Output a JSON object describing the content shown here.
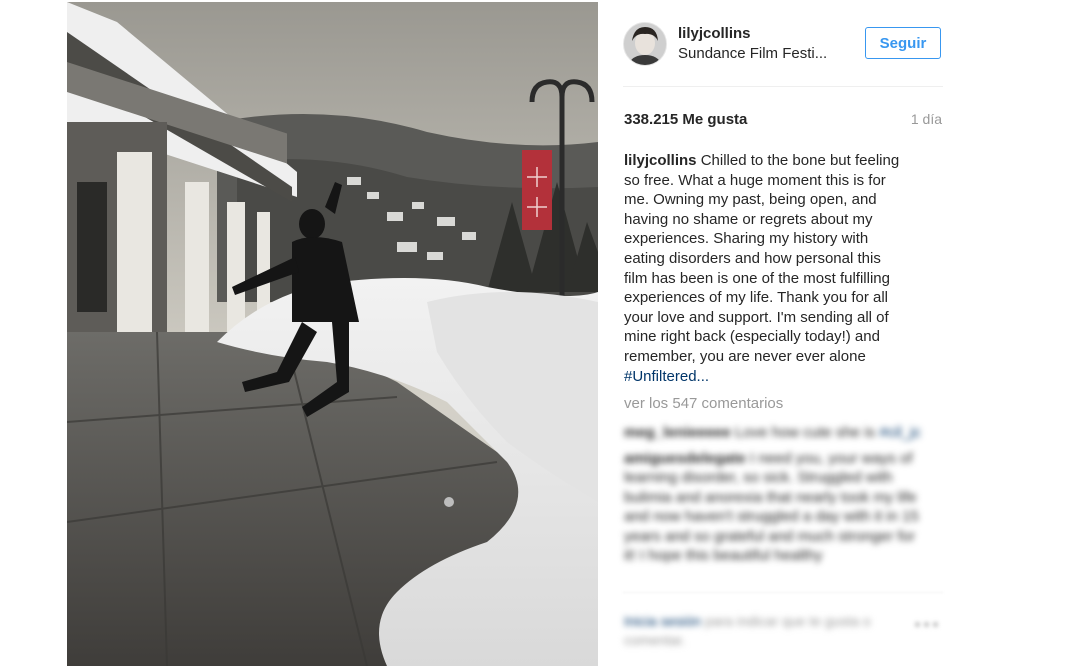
{
  "post": {
    "photo_icon": "jumping-person-in-snow-photo",
    "author": {
      "username": "lilyjcollins",
      "location": "Sundance Film Festi..."
    },
    "follow_label": "Seguir",
    "likes": "338.215 Me gusta",
    "time_ago": "1 día",
    "caption": {
      "username": "lilyjcollins",
      "lines": [
        "Chilled to the bone but feeling",
        "so free. What a huge moment this is for",
        "me. Owning my past, being open, and",
        "having no shame or regrets about my",
        "experiences. Sharing my history with",
        "eating disorders and how personal this",
        "film has been is one of the most fulfilling",
        "experiences of my life. Thank you for all",
        "your love and support. I'm sending all of",
        "mine right back (especially today!) and",
        "remember, you are never ever alone"
      ],
      "hashtag": "#Unfiltered..."
    },
    "view_comments": "ver los 547 comentarios",
    "comments": [
      {
        "user": "meg_lenieeeee",
        "text": "Love how cute she is",
        "tag": "#cil_jc"
      },
      {
        "user": "amiguesdelegate",
        "text": "I need you, your ways of learning disorder, so sick. Struggled with bulimia and anorexia that nearly took my life and now haven't struggled a day with it in 15 years and so grateful and much stronger for it! I hope this beautiful healthy"
      }
    ],
    "login_prompt": {
      "link": "Inicia sesión",
      "text": "para indicar que te gusta o comentar."
    },
    "colors": {
      "accent": "#3897f0",
      "hashtag": "#003569",
      "muted": "#999999"
    }
  }
}
